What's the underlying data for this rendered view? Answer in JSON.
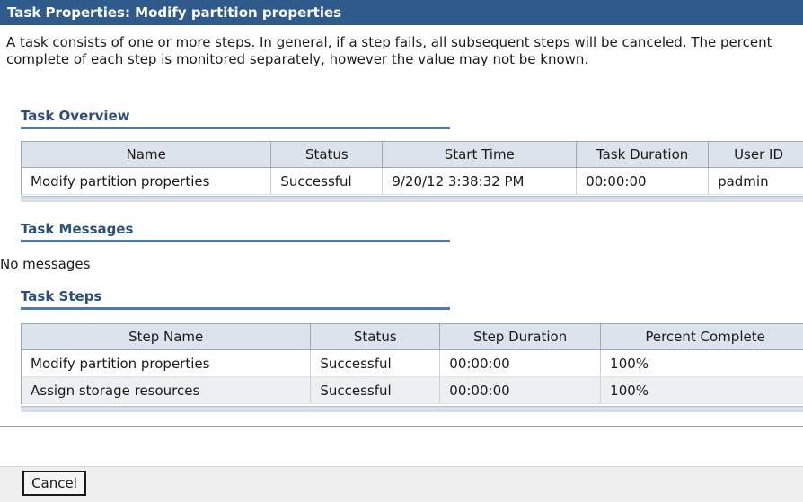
{
  "window": {
    "title": "Task Properties: Modify partition properties"
  },
  "description": "A task consists of one or more steps. In general, if a step fails, all subsequent steps will be canceled. The percent complete of each step is monitored separately, however the value may not be known.",
  "overview": {
    "heading": "Task Overview",
    "columns": [
      "Name",
      "Status",
      "Start Time",
      "Task Duration",
      "User ID"
    ],
    "row": {
      "name": "Modify partition properties",
      "status": "Successful",
      "start_time": "9/20/12 3:38:32 PM",
      "duration": "00:00:00",
      "user_id": "padmin"
    }
  },
  "messages": {
    "heading": "Task Messages",
    "text": "No messages"
  },
  "steps": {
    "heading": "Task Steps",
    "columns": [
      "Step Name",
      "Status",
      "Step Duration",
      "Percent Complete"
    ],
    "rows": [
      {
        "name": "Modify partition properties",
        "status": "Successful",
        "duration": "00:00:00",
        "percent": "100%"
      },
      {
        "name": "Assign storage resources",
        "status": "Successful",
        "duration": "00:00:00",
        "percent": "100%"
      }
    ]
  },
  "buttons": {
    "cancel": "Cancel"
  }
}
